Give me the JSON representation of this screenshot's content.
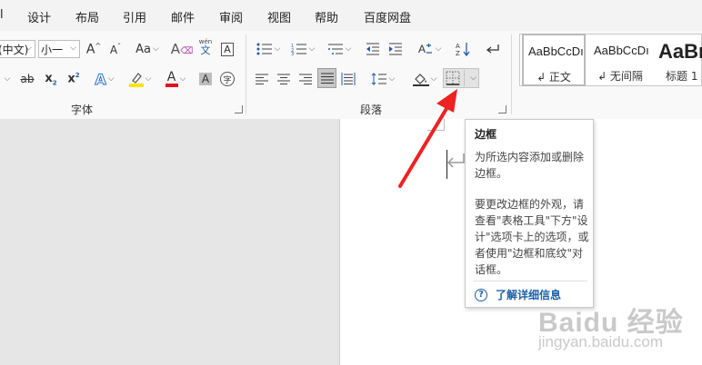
{
  "menu": {
    "items": [
      "设计",
      "布局",
      "引用",
      "邮件",
      "审阅",
      "视图",
      "帮助",
      "百度网盘"
    ],
    "left_fragment": "l"
  },
  "font_group": {
    "font_name": "(中文)",
    "font_size": "小一",
    "label": "字体",
    "phonetic_label": "wén",
    "phonetic_char": "文",
    "case_label": "Aa",
    "highlight_color": "#ffe600",
    "font_color": "#e0141e"
  },
  "paragraph_group": {
    "label": "段落"
  },
  "styles": {
    "items": [
      {
        "sample": "AaBbCcDı",
        "name": "↲ 正文"
      },
      {
        "sample": "AaBbCcDı",
        "name": "↲ 无间隔"
      },
      {
        "sample": "AaBı",
        "name": "标题 1"
      }
    ]
  },
  "tooltip": {
    "title": "边框",
    "description": "为所选内容添加或删除边框。",
    "more": "要更改边框的外观，请查看\"表格工具\"下方\"设计\"选项卡上的选项，或者使用\"边框和底纹\"对话框。",
    "help_link": "了解详细信息"
  },
  "watermark": {
    "logo": "Baidu 经验",
    "url": "jingyan.baidu.com"
  },
  "colors": {
    "arrow": "#ee2222",
    "link": "#1f5ea8"
  }
}
